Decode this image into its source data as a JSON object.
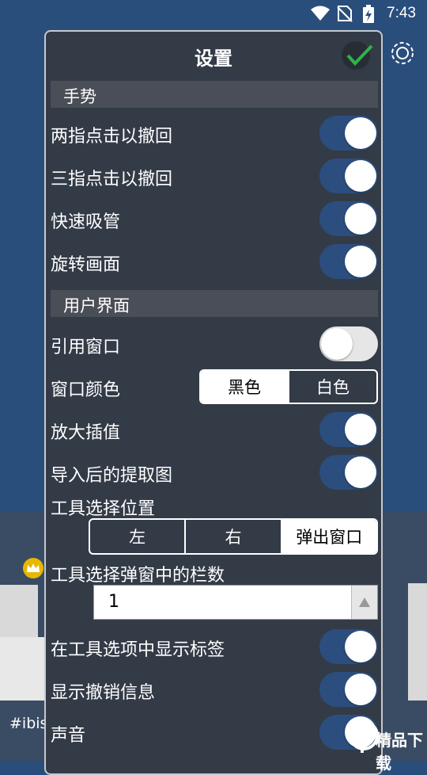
{
  "status_bar": {
    "time": "7:43"
  },
  "background": {
    "hashtag": "#ibisP"
  },
  "dialog": {
    "title": "设置",
    "sections": {
      "gesture": "手势",
      "ui": "用户界面"
    },
    "rows": {
      "two_finger_undo": "两指点击以撤回",
      "three_finger_undo": "三指点击以撤回",
      "quick_eyedropper": "快速吸管",
      "rotate_canvas": "旋转画面",
      "reference_window": "引用窗口",
      "window_color": "窗口颜色",
      "zoom_interpolation": "放大插值",
      "extract_after_import": "导入后的提取图",
      "tool_select_position": "工具选择位置",
      "tool_popup_columns": "工具选择弹窗中的栏数",
      "show_tool_labels": "在工具选项中显示标签",
      "show_undo_info": "显示撤销信息",
      "sound": "声音"
    },
    "toggles": {
      "two_finger_undo": true,
      "three_finger_undo": true,
      "quick_eyedropper": true,
      "rotate_canvas": true,
      "reference_window": false,
      "zoom_interpolation": true,
      "extract_after_import": true,
      "show_tool_labels": true,
      "show_undo_info": true,
      "sound": true
    },
    "window_color_options": [
      "黑色",
      "白色"
    ],
    "window_color_selected": "黑色",
    "tool_position_options": [
      "左",
      "右",
      "弹出窗口"
    ],
    "tool_position_selected": "弹出窗口",
    "columns_value": "1"
  },
  "watermark": {
    "text": "精品下载"
  },
  "colors": {
    "toggle_on": "#2b4e7e",
    "dialog_bg": "#333b47",
    "accent_check": "#2fb34a"
  }
}
